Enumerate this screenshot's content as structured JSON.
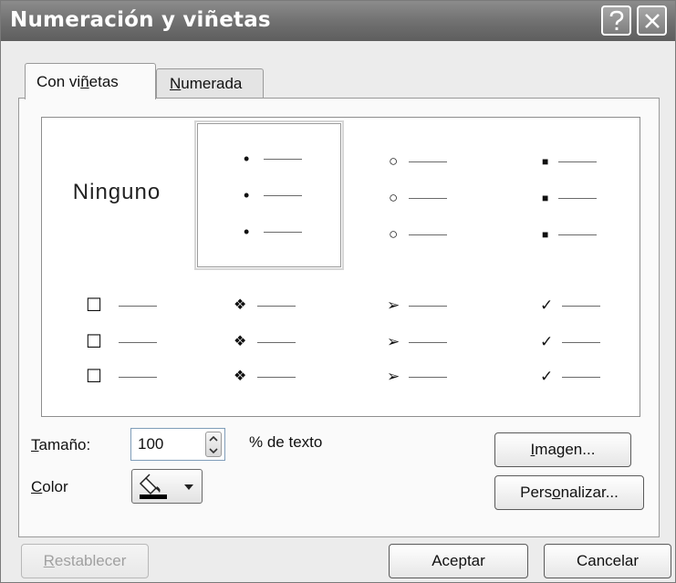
{
  "window": {
    "title": "Numeración y viñetas",
    "help_icon": "question-mark-icon",
    "close_icon": "close-x-icon"
  },
  "tabs": [
    {
      "pre": "Con vi",
      "key": "ñ",
      "post": "etas",
      "active": true
    },
    {
      "pre": "",
      "key": "N",
      "post": "umerada",
      "active": false
    }
  ],
  "gallery": {
    "none_label": "Ninguno",
    "selected": "dot",
    "styles": [
      {
        "id": "none",
        "glyph": ""
      },
      {
        "id": "dot",
        "glyph": "•"
      },
      {
        "id": "circle",
        "glyph": "○"
      },
      {
        "id": "square",
        "glyph": "■"
      },
      {
        "id": "box",
        "glyph": "☐"
      },
      {
        "id": "diamond-dots",
        "glyph": "❖"
      },
      {
        "id": "arrowhead",
        "glyph": "➢"
      },
      {
        "id": "check",
        "glyph": "✓"
      }
    ]
  },
  "options": {
    "size": {
      "pre": "",
      "key": "T",
      "post": "amaño:",
      "value": "100",
      "unit": "% de texto"
    },
    "color": {
      "pre": "",
      "key": "C",
      "post": "olor",
      "swatch": "#000000",
      "icon": "paint-bucket-icon"
    }
  },
  "buttons": {
    "image": {
      "pre": "",
      "key": "I",
      "post": "magen..."
    },
    "customize": {
      "pre": "Pers",
      "key": "o",
      "post": "nalizar..."
    },
    "reset": {
      "pre": "",
      "key": "R",
      "post": "establecer",
      "enabled": false
    },
    "ok": "Aceptar",
    "cancel": "Cancelar"
  }
}
